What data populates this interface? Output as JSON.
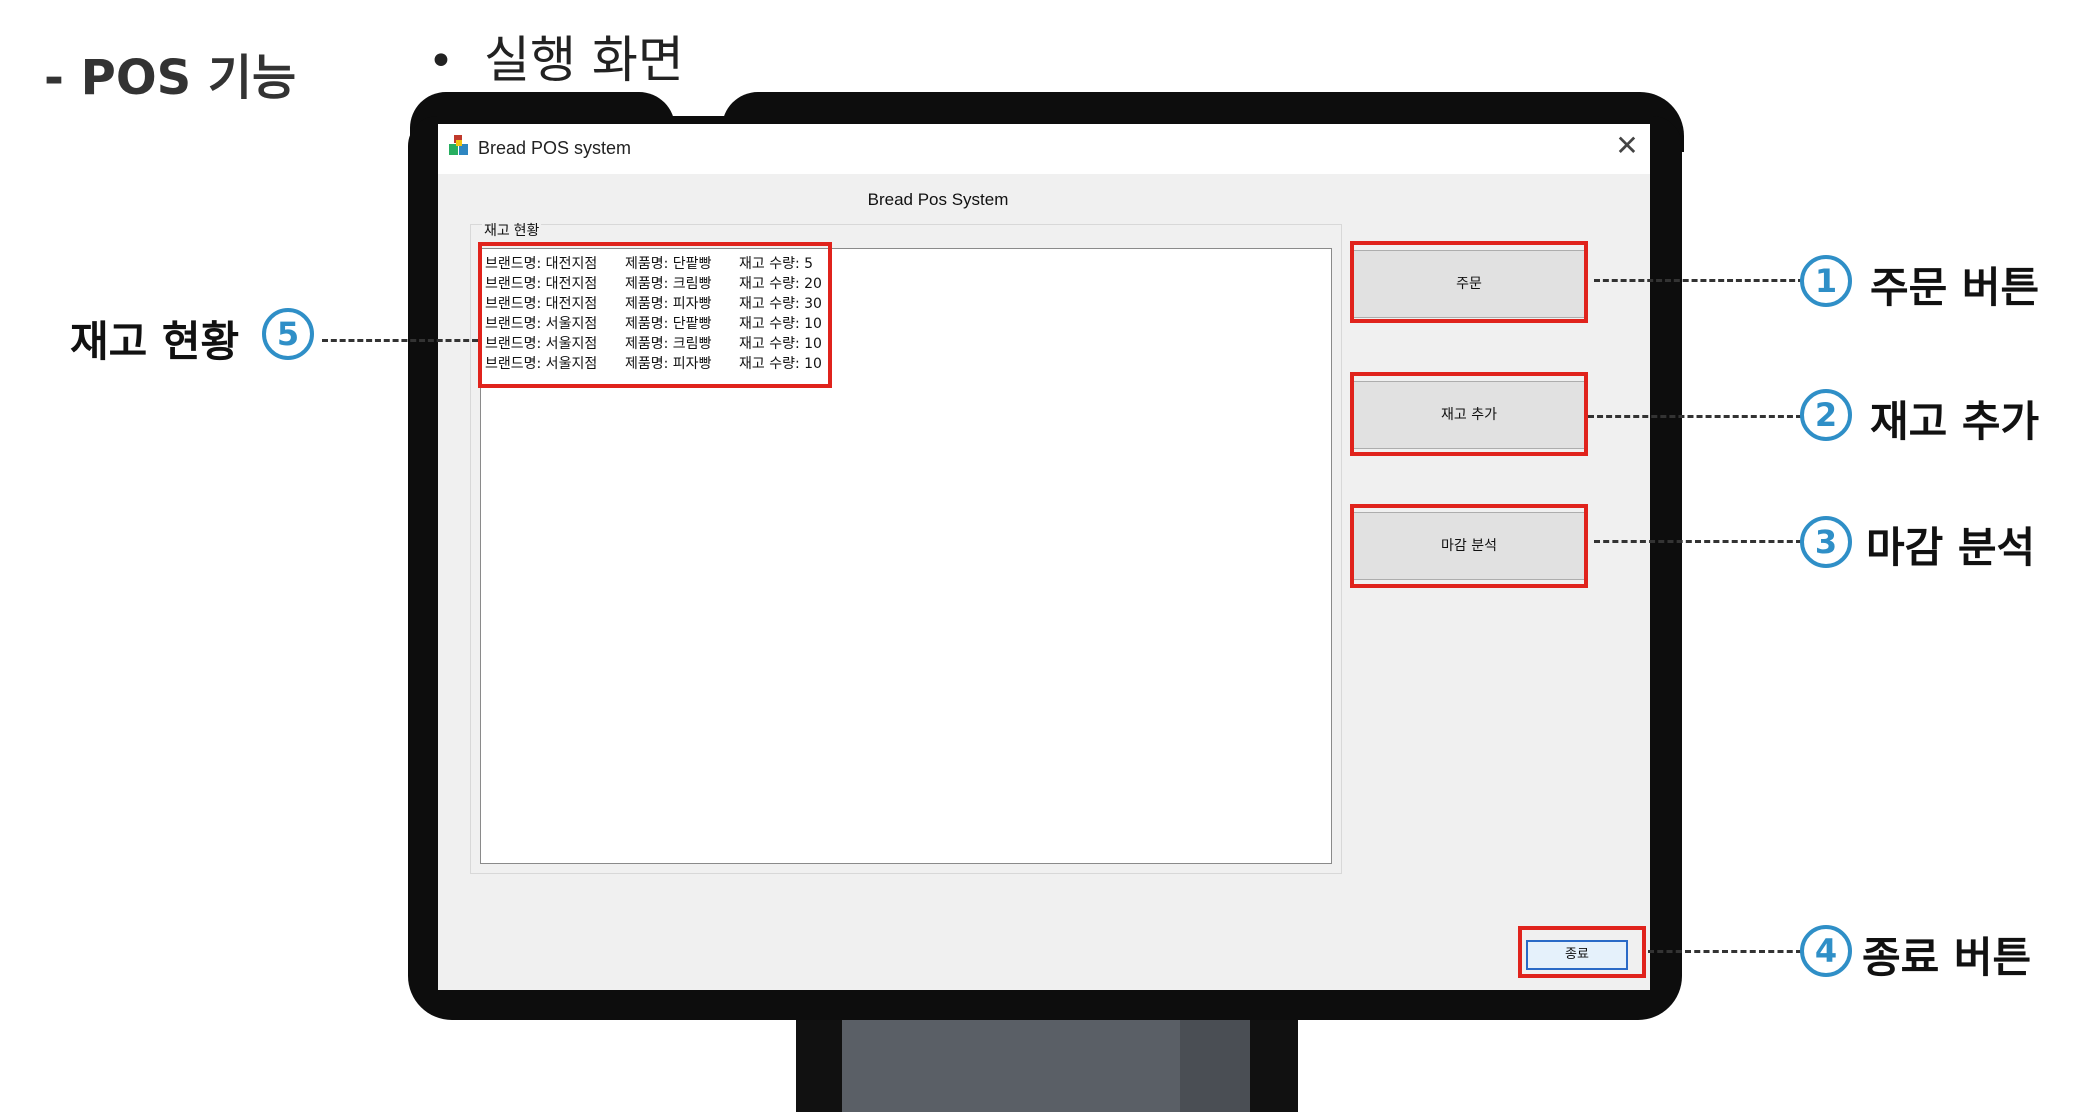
{
  "slide": {
    "section_title": "- POS 기능",
    "bullet": "실행 화면"
  },
  "window": {
    "title": "Bread POS system",
    "heading": "Bread Pos System",
    "close_symbol": "✕",
    "inventory_group_label": "재고 현황",
    "inventory": [
      {
        "brand": "브랜드명: 대전지점",
        "product": "제품명: 단팥빵",
        "qty": "재고 수량: 5"
      },
      {
        "brand": "브랜드명: 대전지점",
        "product": "제품명: 크림빵",
        "qty": "재고 수량: 20"
      },
      {
        "brand": "브랜드명: 대전지점",
        "product": "제품명: 피자빵",
        "qty": "재고 수량: 30"
      },
      {
        "brand": "브랜드명: 서울지점",
        "product": "제품명: 단팥빵",
        "qty": "재고 수량: 10"
      },
      {
        "brand": "브랜드명: 서울지점",
        "product": "제품명: 크림빵",
        "qty": "재고 수량: 10"
      },
      {
        "brand": "브랜드명: 서울지점",
        "product": "제품명: 피자빵",
        "qty": "재고 수량: 10"
      }
    ],
    "buttons": {
      "order": "주문",
      "add_stock": "재고 추가",
      "closing_analysis": "마감 분석",
      "exit": "종료"
    }
  },
  "callouts": {
    "c1": {
      "num": "1",
      "text": "주문 버튼"
    },
    "c2": {
      "num": "2",
      "text": "재고 추가"
    },
    "c3": {
      "num": "3",
      "text": "마감 분석"
    },
    "c4": {
      "num": "4",
      "text": "종료 버튼"
    },
    "c5": {
      "num": "5",
      "text": "재고 현황"
    }
  },
  "colors": {
    "highlight": "#e0231c",
    "callout_circle": "#2f8fc7",
    "bezel": "#0d0d0d"
  }
}
